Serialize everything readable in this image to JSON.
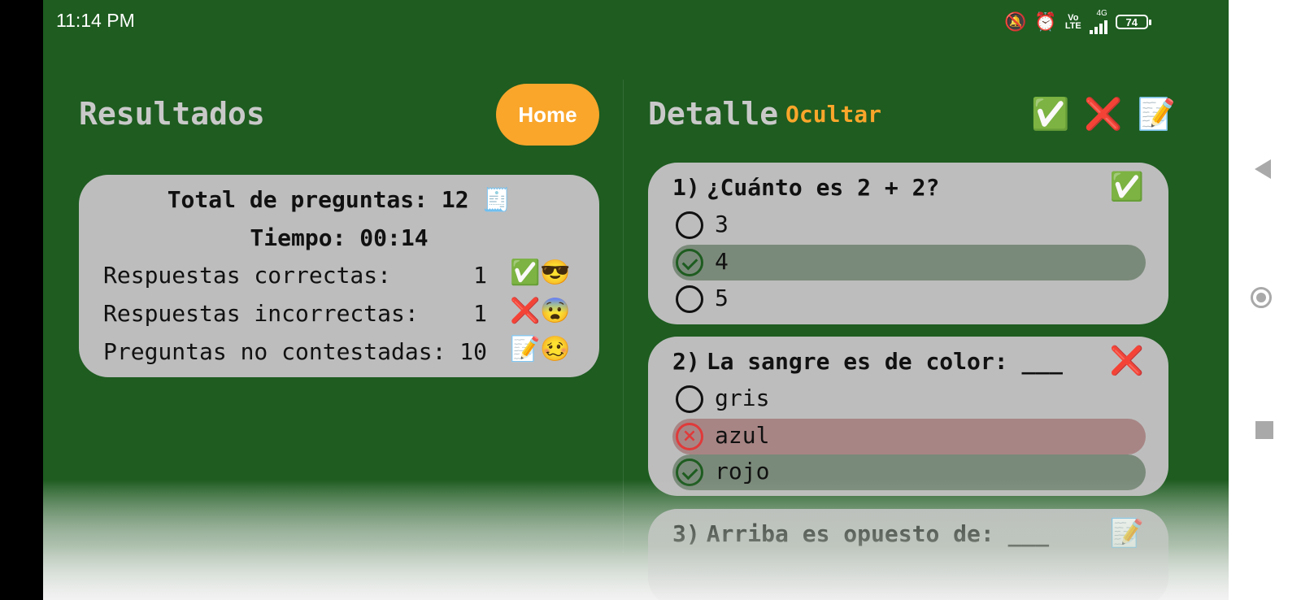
{
  "status_bar": {
    "time": "11:14 PM",
    "icons": {
      "mute": "vibrate-off-icon",
      "alarm": "alarm-icon"
    },
    "volte_top": "Vo",
    "volte_bottom": "LTE",
    "network": "4G",
    "battery": "74"
  },
  "results": {
    "title": "Resultados",
    "home_label": "Home",
    "summary": {
      "total_line": "Total de preguntas: 12 🧾",
      "time_line": "Tiempo: 00:14",
      "rows": [
        {
          "label": "Respuestas correctas:",
          "value": "1",
          "emoji": "✅😎"
        },
        {
          "label": "Respuestas incorrectas:",
          "value": "1",
          "emoji": "❌😨"
        },
        {
          "label": "Preguntas no contestadas:",
          "value": "10",
          "emoji": "📝🥴"
        }
      ]
    }
  },
  "detail": {
    "title": "Detalle",
    "toggle_label": "Ocultar",
    "filters": [
      "✅",
      "❌",
      "📝"
    ],
    "questions": [
      {
        "number": "1)",
        "text": "¿Cuánto es 2 + 2?",
        "status": "✅",
        "options": [
          {
            "label": "3",
            "state": "none"
          },
          {
            "label": "4",
            "state": "correct"
          },
          {
            "label": "5",
            "state": "none"
          }
        ]
      },
      {
        "number": "2)",
        "text": "La sangre es de color: ___",
        "status": "❌",
        "options": [
          {
            "label": "gris",
            "state": "none"
          },
          {
            "label": "azul",
            "state": "wrong"
          },
          {
            "label": "rojo",
            "state": "correct"
          }
        ]
      },
      {
        "number": "3)",
        "text": "Arriba es opuesto de: ___",
        "status": "📝"
      }
    ]
  },
  "colors": {
    "background": "#1e5c20",
    "accent": "#f9a62b",
    "card": "#bdbdbd",
    "correct_option": "#7a8a7a",
    "wrong_option": "#a88585"
  },
  "nav_bar": {
    "back": "back-triangle-icon",
    "home": "home-circle-icon",
    "recents": "recents-square-icon"
  }
}
